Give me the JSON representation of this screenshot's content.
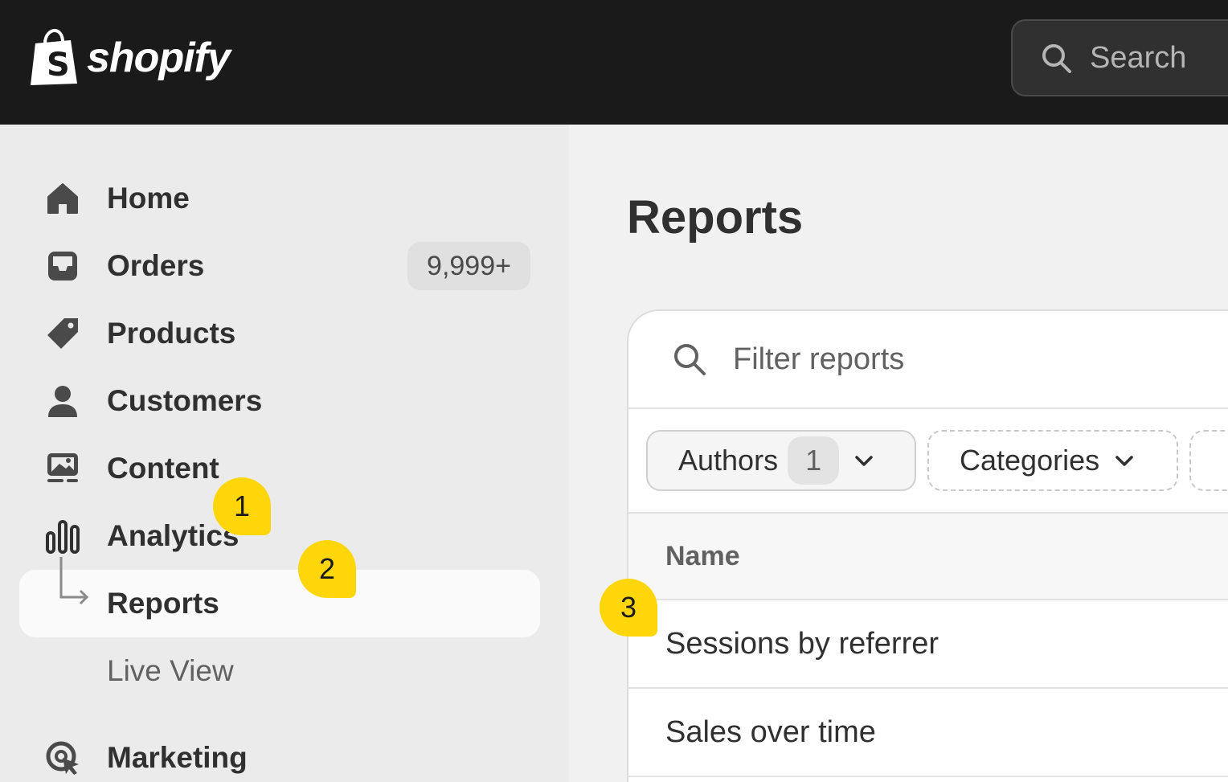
{
  "brand": {
    "name": "shopify"
  },
  "search": {
    "label": "Search"
  },
  "sidebar": {
    "items": [
      {
        "label": "Home",
        "icon": "home-icon"
      },
      {
        "label": "Orders",
        "icon": "inbox-icon",
        "badge": "9,999+"
      },
      {
        "label": "Products",
        "icon": "tag-icon"
      },
      {
        "label": "Customers",
        "icon": "person-icon"
      },
      {
        "label": "Content",
        "icon": "image-icon"
      },
      {
        "label": "Analytics",
        "icon": "bar-chart-icon"
      },
      {
        "label": "Reports",
        "icon": "sub-arrow-icon",
        "active": true
      },
      {
        "label": "Live View"
      },
      {
        "label": "Marketing",
        "icon": "target-icon"
      }
    ]
  },
  "main": {
    "title": "Reports",
    "filter_placeholder": "Filter reports",
    "chips": {
      "authors": "Authors",
      "authors_count": "1",
      "categories": "Categories"
    },
    "table": {
      "column_name": "Name",
      "rows": [
        "Sessions by referrer",
        "Sales over time"
      ]
    }
  },
  "markers": [
    "1",
    "2",
    "3"
  ],
  "colors": {
    "topbar": "#1a1a1a",
    "marker": "#ffd60a",
    "sidebar": "#ebebeb"
  }
}
